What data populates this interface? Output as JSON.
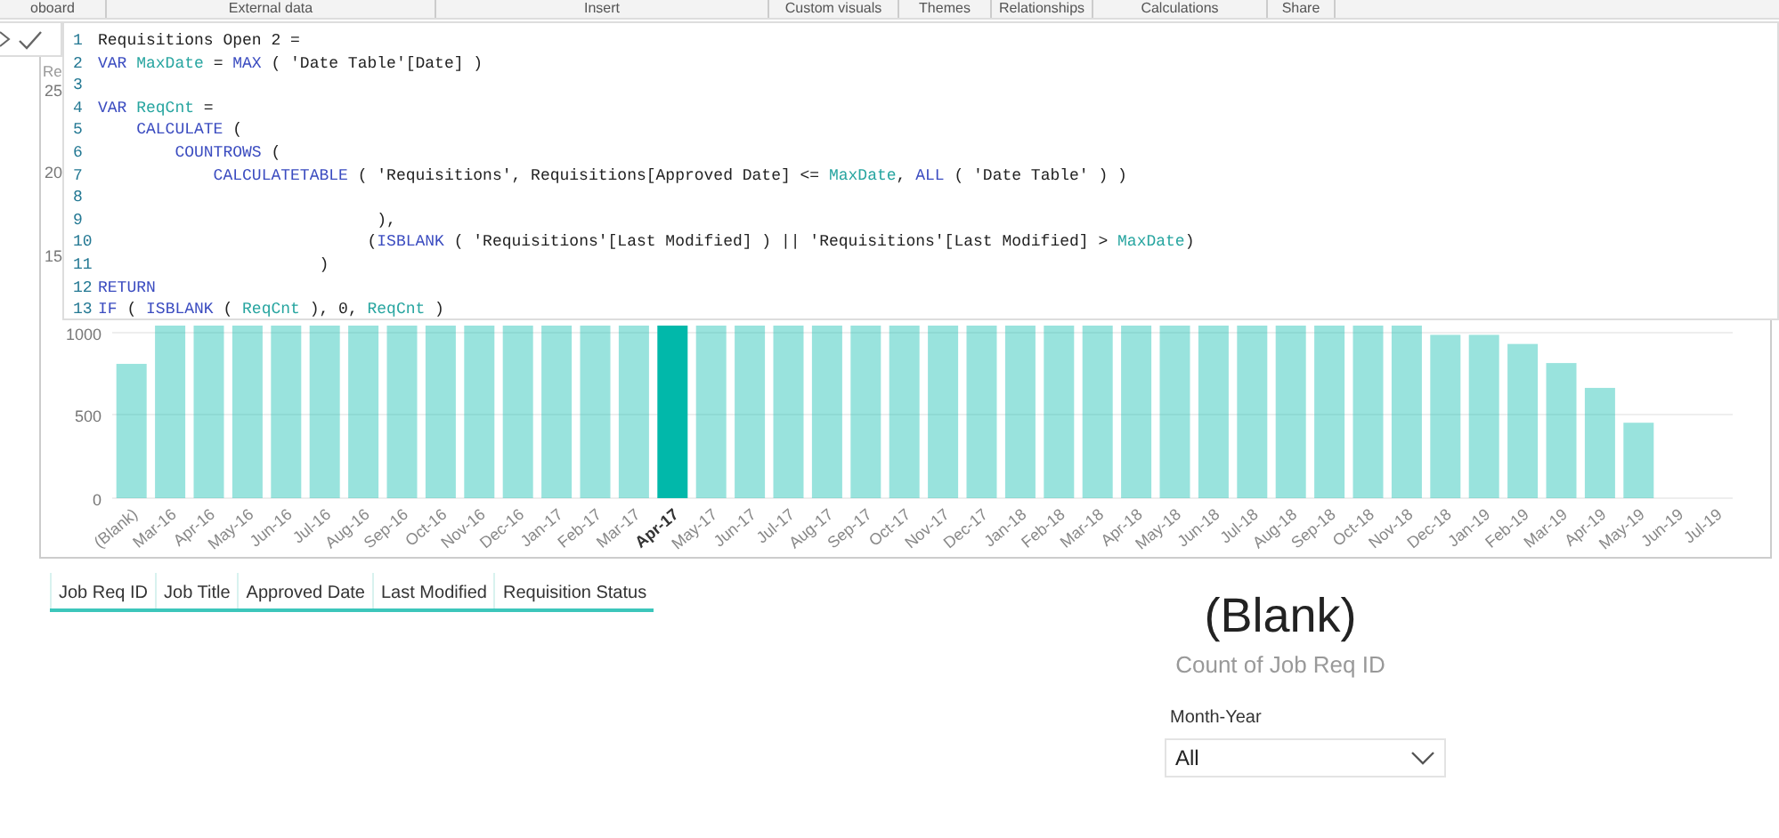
{
  "ribbon": {
    "groups": [
      "oboard",
      "External data",
      "Insert",
      "Custom visuals",
      "Themes",
      "Relationships",
      "Calculations",
      "Share"
    ]
  },
  "formula_editor": {
    "lines": [
      {
        "num": "1",
        "tokens": [
          {
            "text": "Requisitions Open 2 =",
            "kind": "plain"
          }
        ]
      },
      {
        "num": "2",
        "tokens": [
          {
            "text": "VAR ",
            "kind": "keyword"
          },
          {
            "text": "MaxDate",
            "kind": "variable"
          },
          {
            "text": " = ",
            "kind": "plain"
          },
          {
            "text": "MAX",
            "kind": "keyword"
          },
          {
            "text": " ( 'Date Table'[Date] )",
            "kind": "plain"
          }
        ]
      },
      {
        "num": "3"
      },
      {
        "num": "4",
        "tokens": [
          {
            "text": "VAR ",
            "kind": "keyword"
          },
          {
            "text": "ReqCnt",
            "kind": "variable"
          },
          {
            "text": " =",
            "kind": "plain"
          }
        ]
      },
      {
        "num": "5",
        "tokens": [
          {
            "text": "    CALCULATE",
            "kind": "keyword"
          },
          {
            "text": " (",
            "kind": "plain"
          }
        ]
      },
      {
        "num": "6",
        "tokens": [
          {
            "text": "        COUNTROWS",
            "kind": "keyword"
          },
          {
            "text": " (",
            "kind": "plain"
          }
        ]
      },
      {
        "num": "7",
        "tokens": [
          {
            "text": "            CALCULATETABLE",
            "kind": "keyword"
          },
          {
            "text": " ( 'Requisitions', Requisitions[Approved Date] <= ",
            "kind": "plain"
          },
          {
            "text": "MaxDate",
            "kind": "variable"
          },
          {
            "text": ", ",
            "kind": "plain"
          },
          {
            "text": "ALL",
            "kind": "keyword"
          },
          {
            "text": " ( 'Date Table' ) )",
            "kind": "plain"
          }
        ]
      },
      {
        "num": "8"
      },
      {
        "num": "9",
        "tokens": [
          {
            "text": "                             ),",
            "kind": "plain"
          }
        ]
      },
      {
        "num": "10",
        "tokens": [
          {
            "text": "                            (",
            "kind": "plain"
          },
          {
            "text": "ISBLANK",
            "kind": "keyword"
          },
          {
            "text": " ( 'Requisitions'[Last Modified] ) || 'Requisitions'[Last Modified] > ",
            "kind": "plain"
          },
          {
            "text": "MaxDate",
            "kind": "variable"
          },
          {
            "text": ")",
            "kind": "plain"
          }
        ]
      },
      {
        "num": "11",
        "tokens": [
          {
            "text": "                       )",
            "kind": "plain"
          }
        ]
      },
      {
        "num": "12",
        "tokens": [
          {
            "text": "RETURN",
            "kind": "keyword"
          }
        ]
      },
      {
        "num": "13",
        "tokens": [
          {
            "text": "IF",
            "kind": "keyword"
          },
          {
            "text": " ( ",
            "kind": "plain"
          },
          {
            "text": "ISBLANK",
            "kind": "keyword"
          },
          {
            "text": " ( ",
            "kind": "plain"
          },
          {
            "text": "ReqCnt",
            "kind": "variable"
          },
          {
            "text": " ), 0, ",
            "kind": "plain"
          },
          {
            "text": "ReqCnt",
            "kind": "variable"
          },
          {
            "text": " )",
            "kind": "plain"
          }
        ]
      }
    ]
  },
  "chart": {
    "title": "Re",
    "y_labels": [
      "25",
      "20",
      "15",
      "1000",
      "500",
      "0"
    ],
    "x_labels": [
      {
        "text": "(Blank)",
        "selected": false
      },
      {
        "text": "Mar-16",
        "selected": false
      },
      {
        "text": "Apr-16",
        "selected": false
      },
      {
        "text": "May-16",
        "selected": false
      },
      {
        "text": "Jun-16",
        "selected": false
      },
      {
        "text": "Jul-16",
        "selected": false
      },
      {
        "text": "Aug-16",
        "selected": false
      },
      {
        "text": "Sep-16",
        "selected": false
      },
      {
        "text": "Oct-16",
        "selected": false
      },
      {
        "text": "Nov-16",
        "selected": false
      },
      {
        "text": "Dec-16",
        "selected": false
      },
      {
        "text": "Jan-17",
        "selected": false
      },
      {
        "text": "Feb-17",
        "selected": false
      },
      {
        "text": "Mar-17",
        "selected": false
      },
      {
        "text": "Apr-17",
        "selected": true
      },
      {
        "text": "May-17",
        "selected": false
      },
      {
        "text": "Jun-17",
        "selected": false
      },
      {
        "text": "Jul-17",
        "selected": false
      },
      {
        "text": "Aug-17",
        "selected": false
      },
      {
        "text": "Sep-17",
        "selected": false
      },
      {
        "text": "Oct-17",
        "selected": false
      },
      {
        "text": "Nov-17",
        "selected": false
      },
      {
        "text": "Dec-17",
        "selected": false
      },
      {
        "text": "Jan-18",
        "selected": false
      },
      {
        "text": "Feb-18",
        "selected": false
      },
      {
        "text": "Mar-18",
        "selected": false
      },
      {
        "text": "Apr-18",
        "selected": false
      },
      {
        "text": "May-18",
        "selected": false
      },
      {
        "text": "Jun-18",
        "selected": false
      },
      {
        "text": "Jul-18",
        "selected": false
      },
      {
        "text": "Aug-18",
        "selected": false
      },
      {
        "text": "Sep-18",
        "selected": false
      },
      {
        "text": "Oct-18",
        "selected": false
      },
      {
        "text": "Nov-18",
        "selected": false
      },
      {
        "text": "Dec-18",
        "selected": false
      },
      {
        "text": "Jan-19",
        "selected": false
      },
      {
        "text": "Feb-19",
        "selected": false
      },
      {
        "text": "Mar-19",
        "selected": false
      },
      {
        "text": "Apr-19",
        "selected": false
      },
      {
        "text": "May-19",
        "selected": false
      },
      {
        "text": "Jun-19",
        "selected": false
      },
      {
        "text": "Jul-19",
        "selected": false
      }
    ]
  },
  "table": {
    "columns": [
      "Job Req ID",
      "Job Title",
      "Approved Date",
      "Last Modified",
      "Requisition Status"
    ]
  },
  "card": {
    "value": "(Blank)",
    "label": "Count of Job Req ID"
  },
  "slicer": {
    "title": "Month-Year",
    "value": "All"
  }
}
